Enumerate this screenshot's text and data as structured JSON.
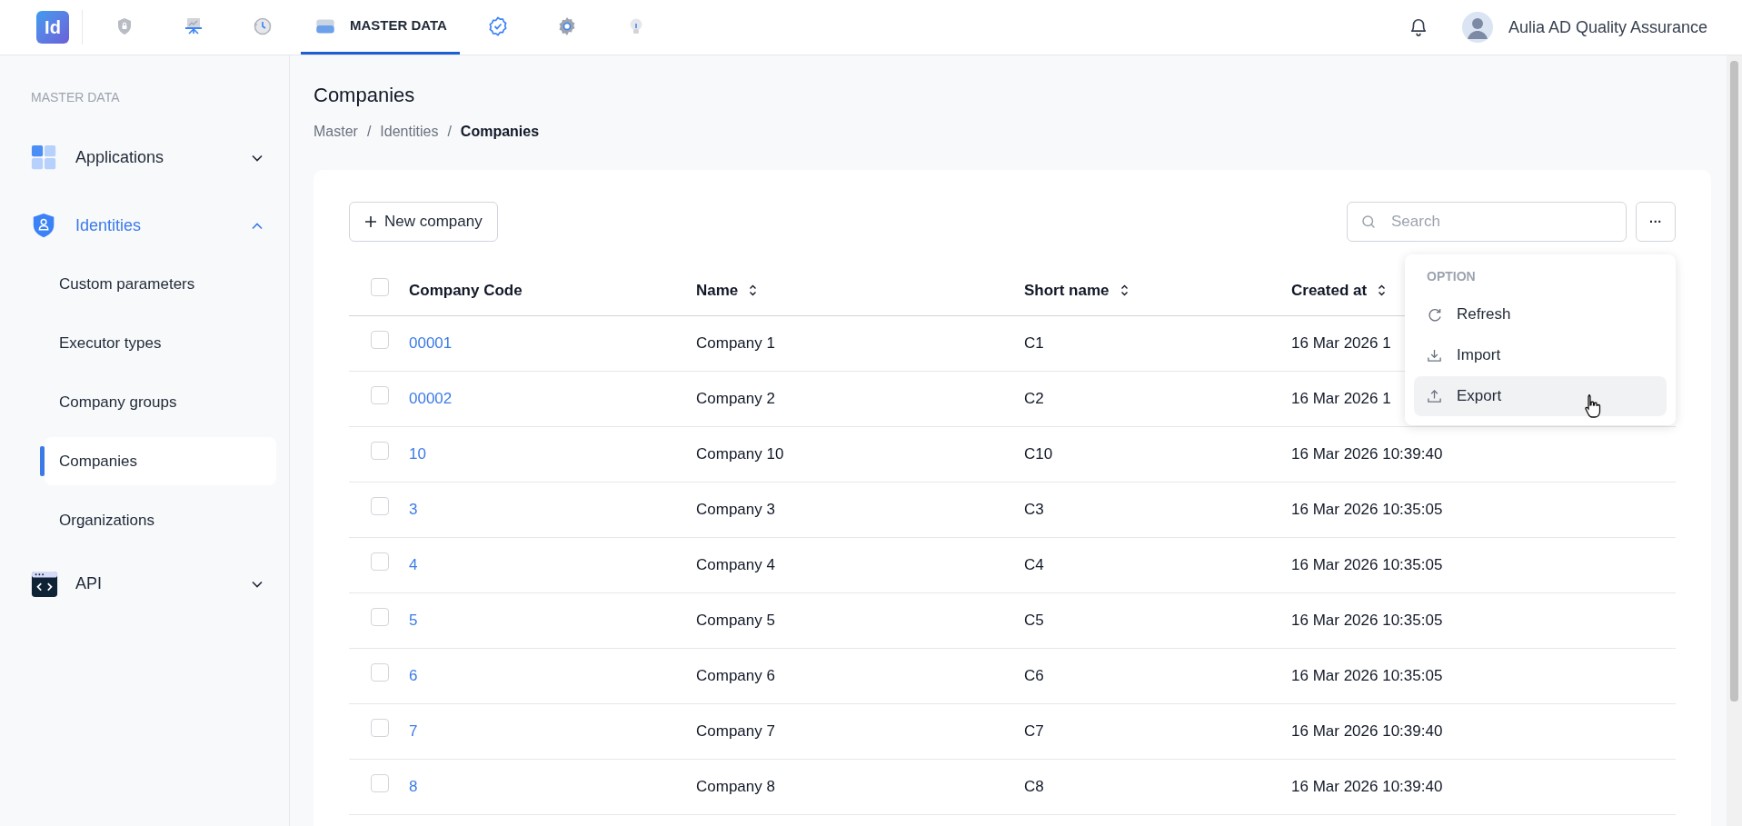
{
  "app": {
    "logo": "Id"
  },
  "nav": [
    {
      "selected": false
    },
    {
      "selected": false
    },
    {
      "selected": false
    },
    {
      "label": "MASTER DATA",
      "selected": true
    },
    {
      "selected": false
    },
    {
      "selected": false
    },
    {
      "selected": false
    }
  ],
  "user": {
    "name": "Aulia AD Quality Assurance"
  },
  "sidebar": {
    "section": "MASTER DATA",
    "groups": [
      {
        "label": "Applications",
        "expanded": false
      },
      {
        "label": "Identities",
        "expanded": true,
        "children": [
          {
            "label": "Custom parameters",
            "selected": false
          },
          {
            "label": "Executor types",
            "selected": false
          },
          {
            "label": "Company groups",
            "selected": false
          },
          {
            "label": "Companies",
            "selected": true
          },
          {
            "label": "Organizations",
            "selected": false
          }
        ]
      },
      {
        "label": "API",
        "expanded": false
      }
    ]
  },
  "page": {
    "title": "Companies",
    "breadcrumb": [
      {
        "kind": "link",
        "text": "Master"
      },
      {
        "kind": "separator",
        "text": "/"
      },
      {
        "kind": "link",
        "text": "Identities"
      },
      {
        "kind": "separator",
        "text": "/"
      },
      {
        "kind": "current",
        "text": "Companies"
      }
    ]
  },
  "toolbar": {
    "new_button": "New company",
    "search": {
      "placeholder": "Search"
    },
    "more_button": "···"
  },
  "table": {
    "all_checked": false,
    "columns": [
      {
        "label": "Company Code",
        "sortable": false
      },
      {
        "label": "Name",
        "sortable": true
      },
      {
        "label": "Short name",
        "sortable": true
      },
      {
        "label": "Created at",
        "sortable": true
      }
    ],
    "rows": [
      {
        "checked": false,
        "cells": [
          "00001",
          "Company 1",
          "C1",
          "16 Mar 2026 1"
        ]
      },
      {
        "checked": false,
        "cells": [
          "00002",
          "Company 2",
          "C2",
          "16 Mar 2026 1"
        ]
      },
      {
        "checked": false,
        "cells": [
          "10",
          "Company 10",
          "C10",
          "16 Mar 2026 10:39:40"
        ]
      },
      {
        "checked": false,
        "cells": [
          "3",
          "Company 3",
          "C3",
          "16 Mar 2026 10:35:05"
        ]
      },
      {
        "checked": false,
        "cells": [
          "4",
          "Company 4",
          "C4",
          "16 Mar 2026 10:35:05"
        ]
      },
      {
        "checked": false,
        "cells": [
          "5",
          "Company 5",
          "C5",
          "16 Mar 2026 10:35:05"
        ]
      },
      {
        "checked": false,
        "cells": [
          "6",
          "Company 6",
          "C6",
          "16 Mar 2026 10:35:05"
        ]
      },
      {
        "checked": false,
        "cells": [
          "7",
          "Company 7",
          "C7",
          "16 Mar 2026 10:39:40"
        ]
      },
      {
        "checked": false,
        "cells": [
          "8",
          "Company 8",
          "C8",
          "16 Mar 2026 10:39:40"
        ]
      }
    ]
  },
  "menu": {
    "header": "OPTION",
    "items": [
      {
        "label": "Refresh",
        "highlighted": false
      },
      {
        "label": "Import",
        "highlighted": false
      },
      {
        "label": "Export",
        "highlighted": true
      }
    ]
  }
}
